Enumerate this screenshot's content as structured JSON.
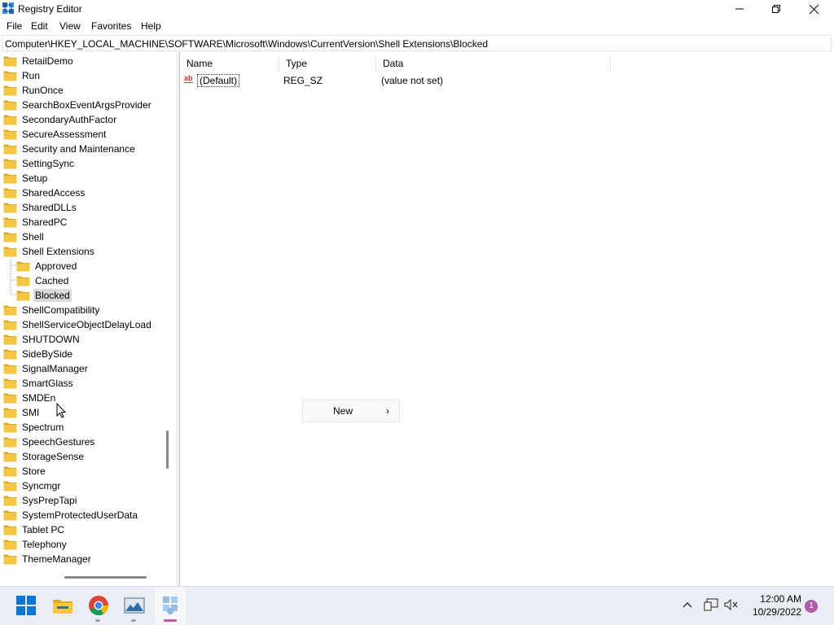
{
  "window": {
    "title": "Registry Editor",
    "minimize": "—",
    "restore": "❐",
    "close": "✕"
  },
  "menu": [
    "File",
    "Edit",
    "View",
    "Favorites",
    "Help"
  ],
  "address": "Computer\\HKEY_LOCAL_MACHINE\\SOFTWARE\\Microsoft\\Windows\\CurrentVersion\\Shell Extensions\\Blocked",
  "tree": {
    "items": [
      {
        "label": "RetailDemo",
        "level": 0
      },
      {
        "label": "Run",
        "level": 0
      },
      {
        "label": "RunOnce",
        "level": 0
      },
      {
        "label": "SearchBoxEventArgsProvider",
        "level": 0
      },
      {
        "label": "SecondaryAuthFactor",
        "level": 0
      },
      {
        "label": "SecureAssessment",
        "level": 0
      },
      {
        "label": "Security and Maintenance",
        "level": 0
      },
      {
        "label": "SettingSync",
        "level": 0
      },
      {
        "label": "Setup",
        "level": 0
      },
      {
        "label": "SharedAccess",
        "level": 0
      },
      {
        "label": "SharedDLLs",
        "level": 0
      },
      {
        "label": "SharedPC",
        "level": 0
      },
      {
        "label": "Shell",
        "level": 0
      },
      {
        "label": "Shell Extensions",
        "level": 0
      },
      {
        "label": "Approved",
        "level": 1
      },
      {
        "label": "Cached",
        "level": 1
      },
      {
        "label": "Blocked",
        "level": 1,
        "selected": true
      },
      {
        "label": "ShellCompatibility",
        "level": 0
      },
      {
        "label": "ShellServiceObjectDelayLoad",
        "level": 0
      },
      {
        "label": "SHUTDOWN",
        "level": 0
      },
      {
        "label": "SideBySide",
        "level": 0
      },
      {
        "label": "SignalManager",
        "level": 0
      },
      {
        "label": "SmartGlass",
        "level": 0
      },
      {
        "label": "SMDEn",
        "level": 0
      },
      {
        "label": "SMI",
        "level": 0
      },
      {
        "label": "Spectrum",
        "level": 0
      },
      {
        "label": "SpeechGestures",
        "level": 0
      },
      {
        "label": "StorageSense",
        "level": 0
      },
      {
        "label": "Store",
        "level": 0
      },
      {
        "label": "Syncmgr",
        "level": 0
      },
      {
        "label": "SysPrepTapi",
        "level": 0
      },
      {
        "label": "SystemProtectedUserData",
        "level": 0
      },
      {
        "label": "Tablet PC",
        "level": 0
      },
      {
        "label": "Telephony",
        "level": 0
      },
      {
        "label": "ThemeManager",
        "level": 0
      }
    ]
  },
  "values_list": {
    "columns": {
      "name": "Name",
      "type": "Type",
      "data": "Data"
    },
    "rows": [
      {
        "name": "(Default)",
        "type": "REG_SZ",
        "data": "(value not set)",
        "icon": "ab"
      }
    ]
  },
  "context_menu": {
    "new_label": "New",
    "arrow": "›"
  },
  "taskbar": {
    "time": "12:00 AM",
    "date": "10/29/2022",
    "notification_count": "1",
    "chevron": "^"
  },
  "colors": {
    "folder": "#f2c744",
    "folder_dark": "#e0a82e",
    "win_blue": "#0a78d4",
    "selection": "#d9d9d9"
  }
}
